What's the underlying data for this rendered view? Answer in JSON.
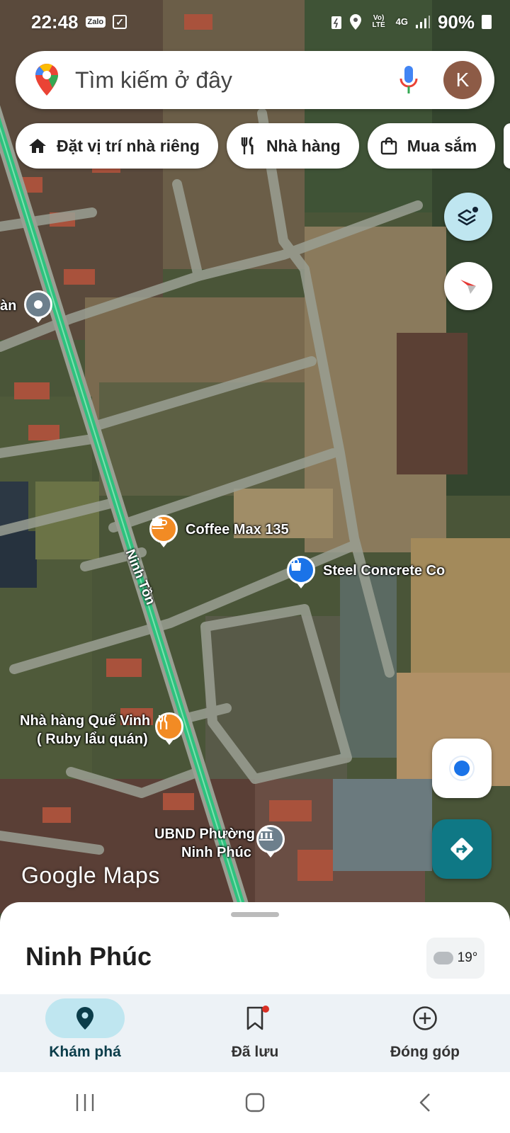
{
  "status_bar": {
    "time": "22:48",
    "app_badge": "Zalo",
    "network": "4G",
    "volte": "Vo) LTE",
    "battery": "90%"
  },
  "search": {
    "placeholder": "Tìm kiếm ở đây",
    "avatar_letter": "K"
  },
  "chips": [
    {
      "label": "Đặt vị trí nhà riêng",
      "icon": "home-icon"
    },
    {
      "label": "Nhà hàng",
      "icon": "restaurant-icon"
    },
    {
      "label": "Mua sắm",
      "icon": "shopping-bag-icon"
    }
  ],
  "map": {
    "labels": {
      "edge_text": "àn",
      "street": "Ninh Tồn",
      "coffee": "Coffee Max 135",
      "steel": "Steel Concrete Co",
      "restaurant_line1": "Nhà hàng Quế Vinh",
      "restaurant_line2": "( Ruby lẩu quán)",
      "ubnd_line1": "UBND Phường",
      "ubnd_line2": "Ninh Phúc"
    },
    "watermark": "Google Maps"
  },
  "sheet": {
    "title": "Ninh Phúc",
    "temperature": "19°"
  },
  "bottom_nav": [
    {
      "label": "Khám phá",
      "icon": "location-pin-icon",
      "active": true
    },
    {
      "label": "Đã lưu",
      "icon": "bookmark-icon",
      "active": false
    },
    {
      "label": "Đóng góp",
      "icon": "add-circle-icon",
      "active": false
    }
  ],
  "colors": {
    "accent_teal": "#0f7885",
    "active_pill": "#bfe6f0",
    "route_green": "#2ec27e",
    "pin_orange": "#f28b24",
    "pin_blue": "#1a73e8"
  }
}
